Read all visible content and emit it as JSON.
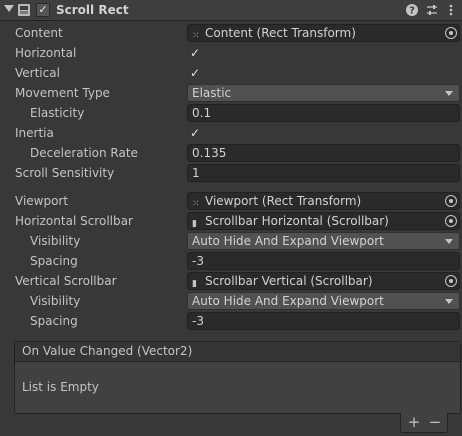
{
  "component": {
    "title": "Scroll Rect",
    "enabled_mark": "✓",
    "icons": [
      "foldout-arrow-icon",
      "component-icon",
      "help-icon",
      "presets-icon",
      "more-icon"
    ]
  },
  "props": {
    "content": {
      "label": "Content",
      "value": "Content (Rect Transform)",
      "icon": "rect-transform-icon"
    },
    "horizontal": {
      "label": "Horizontal",
      "checked": "✓"
    },
    "vertical": {
      "label": "Vertical",
      "checked": "✓"
    },
    "movement_type": {
      "label": "Movement Type",
      "value": "Elastic"
    },
    "elasticity": {
      "label": "Elasticity",
      "value": "0.1"
    },
    "inertia": {
      "label": "Inertia",
      "checked": "✓"
    },
    "deceleration_rate": {
      "label": "Deceleration Rate",
      "value": "0.135"
    },
    "scroll_sensitivity": {
      "label": "Scroll Sensitivity",
      "value": "1"
    },
    "viewport": {
      "label": "Viewport",
      "value": "Viewport (Rect Transform)",
      "icon": "rect-transform-icon"
    },
    "horizontal_scrollbar": {
      "label": "Horizontal Scrollbar",
      "value": "Scrollbar Horizontal (Scrollbar)",
      "icon": "script-icon"
    },
    "h_visibility": {
      "label": "Visibility",
      "value": "Auto Hide And Expand Viewport"
    },
    "h_spacing": {
      "label": "Spacing",
      "value": "-3"
    },
    "vertical_scrollbar": {
      "label": "Vertical Scrollbar",
      "value": "Scrollbar Vertical (Scrollbar)",
      "icon": "script-icon"
    },
    "v_visibility": {
      "label": "Visibility",
      "value": "Auto Hide And Expand Viewport"
    },
    "v_spacing": {
      "label": "Spacing",
      "value": "-3"
    }
  },
  "event": {
    "header": "On Value Changed (Vector2)",
    "empty_text": "List is Empty",
    "add_label": "+",
    "remove_label": "−"
  }
}
